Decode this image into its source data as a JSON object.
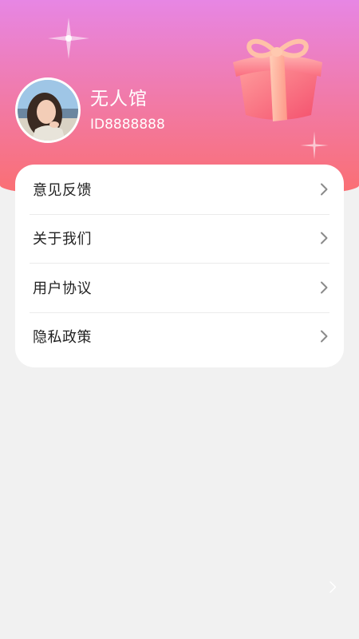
{
  "profile": {
    "username": "无人馆",
    "user_id": "ID8888888"
  },
  "menu": {
    "items": [
      {
        "label": "意见反馈"
      },
      {
        "label": "关于我们"
      },
      {
        "label": "用户协议"
      },
      {
        "label": "隐私政策"
      }
    ]
  },
  "colors": {
    "header_gradient_top": "#e786e4",
    "header_gradient_bottom": "#fb6e6f",
    "page_background": "#f1f1f1",
    "card_background": "#ffffff"
  },
  "icons": {
    "header_decoration": "gift-box-icon",
    "menu_chevron": "chevron-right-icon",
    "sparkle": "sparkle-icon"
  }
}
